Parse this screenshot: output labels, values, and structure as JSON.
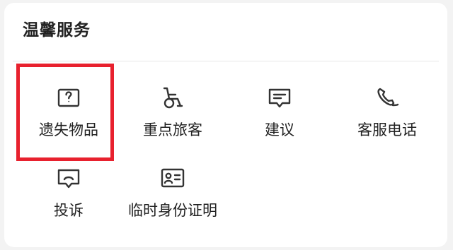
{
  "section": {
    "title": "温馨服务"
  },
  "services": [
    {
      "label": "遗失物品",
      "icon": "question-box-icon"
    },
    {
      "label": "重点旅客",
      "icon": "wheelchair-icon"
    },
    {
      "label": "建议",
      "icon": "message-square-icon"
    },
    {
      "label": "客服电话",
      "icon": "phone-icon"
    },
    {
      "label": "投诉",
      "icon": "complaint-face-icon"
    },
    {
      "label": "临时身份证明",
      "icon": "id-card-icon"
    }
  ],
  "highlight": {
    "target": "遗失物品",
    "color": "#e8212e"
  },
  "colors": {
    "icon": "#333333",
    "text": "#222222",
    "card_background": "#ffffff",
    "page_background": "#f3f3f3"
  }
}
